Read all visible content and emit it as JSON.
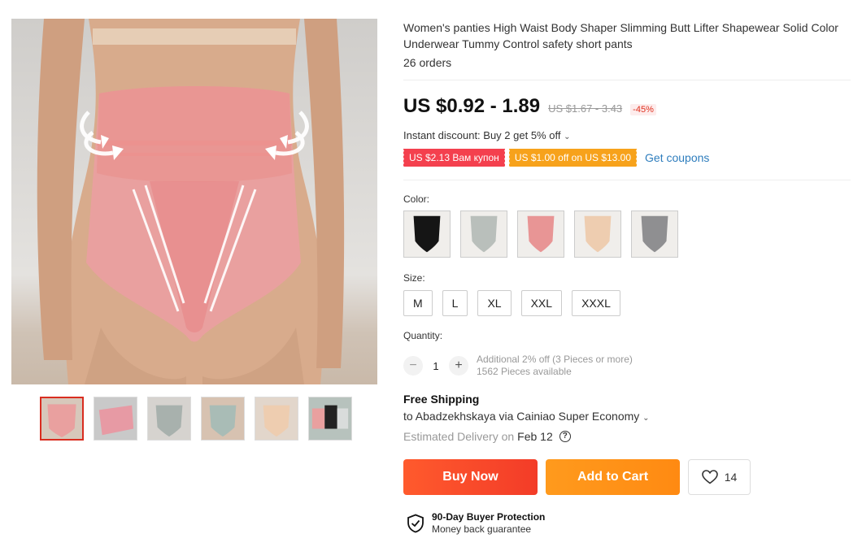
{
  "product": {
    "title": "Women's panties High Waist Body Shaper Slimming Butt Lifter Shapewear Solid Color Underwear Tummy Control safety short pants",
    "orders": "26 orders"
  },
  "price": {
    "current": "US $0.92 - 1.89",
    "original": "US $1.67 - 3.43",
    "discount": "-45%"
  },
  "promo": {
    "instant_discount": "Instant discount: Buy 2 get 5% off",
    "coupons": [
      "US $2.13 Вам купон",
      "US $1.00 off on US $13.00"
    ],
    "get_coupons": "Get coupons"
  },
  "variants": {
    "color_label": "Color:",
    "colors": [
      "#151515",
      "#b9bfbb",
      "#e89595",
      "#eecdb0",
      "#8f8f91"
    ],
    "size_label": "Size:",
    "sizes": [
      "M",
      "L",
      "XL",
      "XXL",
      "XXXL"
    ]
  },
  "quantity": {
    "label": "Quantity:",
    "value": "1",
    "minus": "−",
    "plus": "+",
    "note": "Additional 2% off (3 Pieces or more)",
    "available": "1562 Pieces available"
  },
  "shipping": {
    "title": "Free Shipping",
    "route": "to Abadzekhskaya via Cainiao Super Economy",
    "delivery_label": "Estimated Delivery on",
    "delivery_date": "Feb 12"
  },
  "actions": {
    "buy_now": "Buy Now",
    "add_to_cart": "Add to Cart",
    "wishlist_count": "14"
  },
  "protection": {
    "title": "90-Day Buyer Protection",
    "subtitle": "Money back guarantee"
  },
  "colors": {
    "accent_red": "#f33c28",
    "accent_orange": "#ff8a12",
    "link_blue": "#2e7dbd",
    "product_pink": "#e9a09f"
  }
}
